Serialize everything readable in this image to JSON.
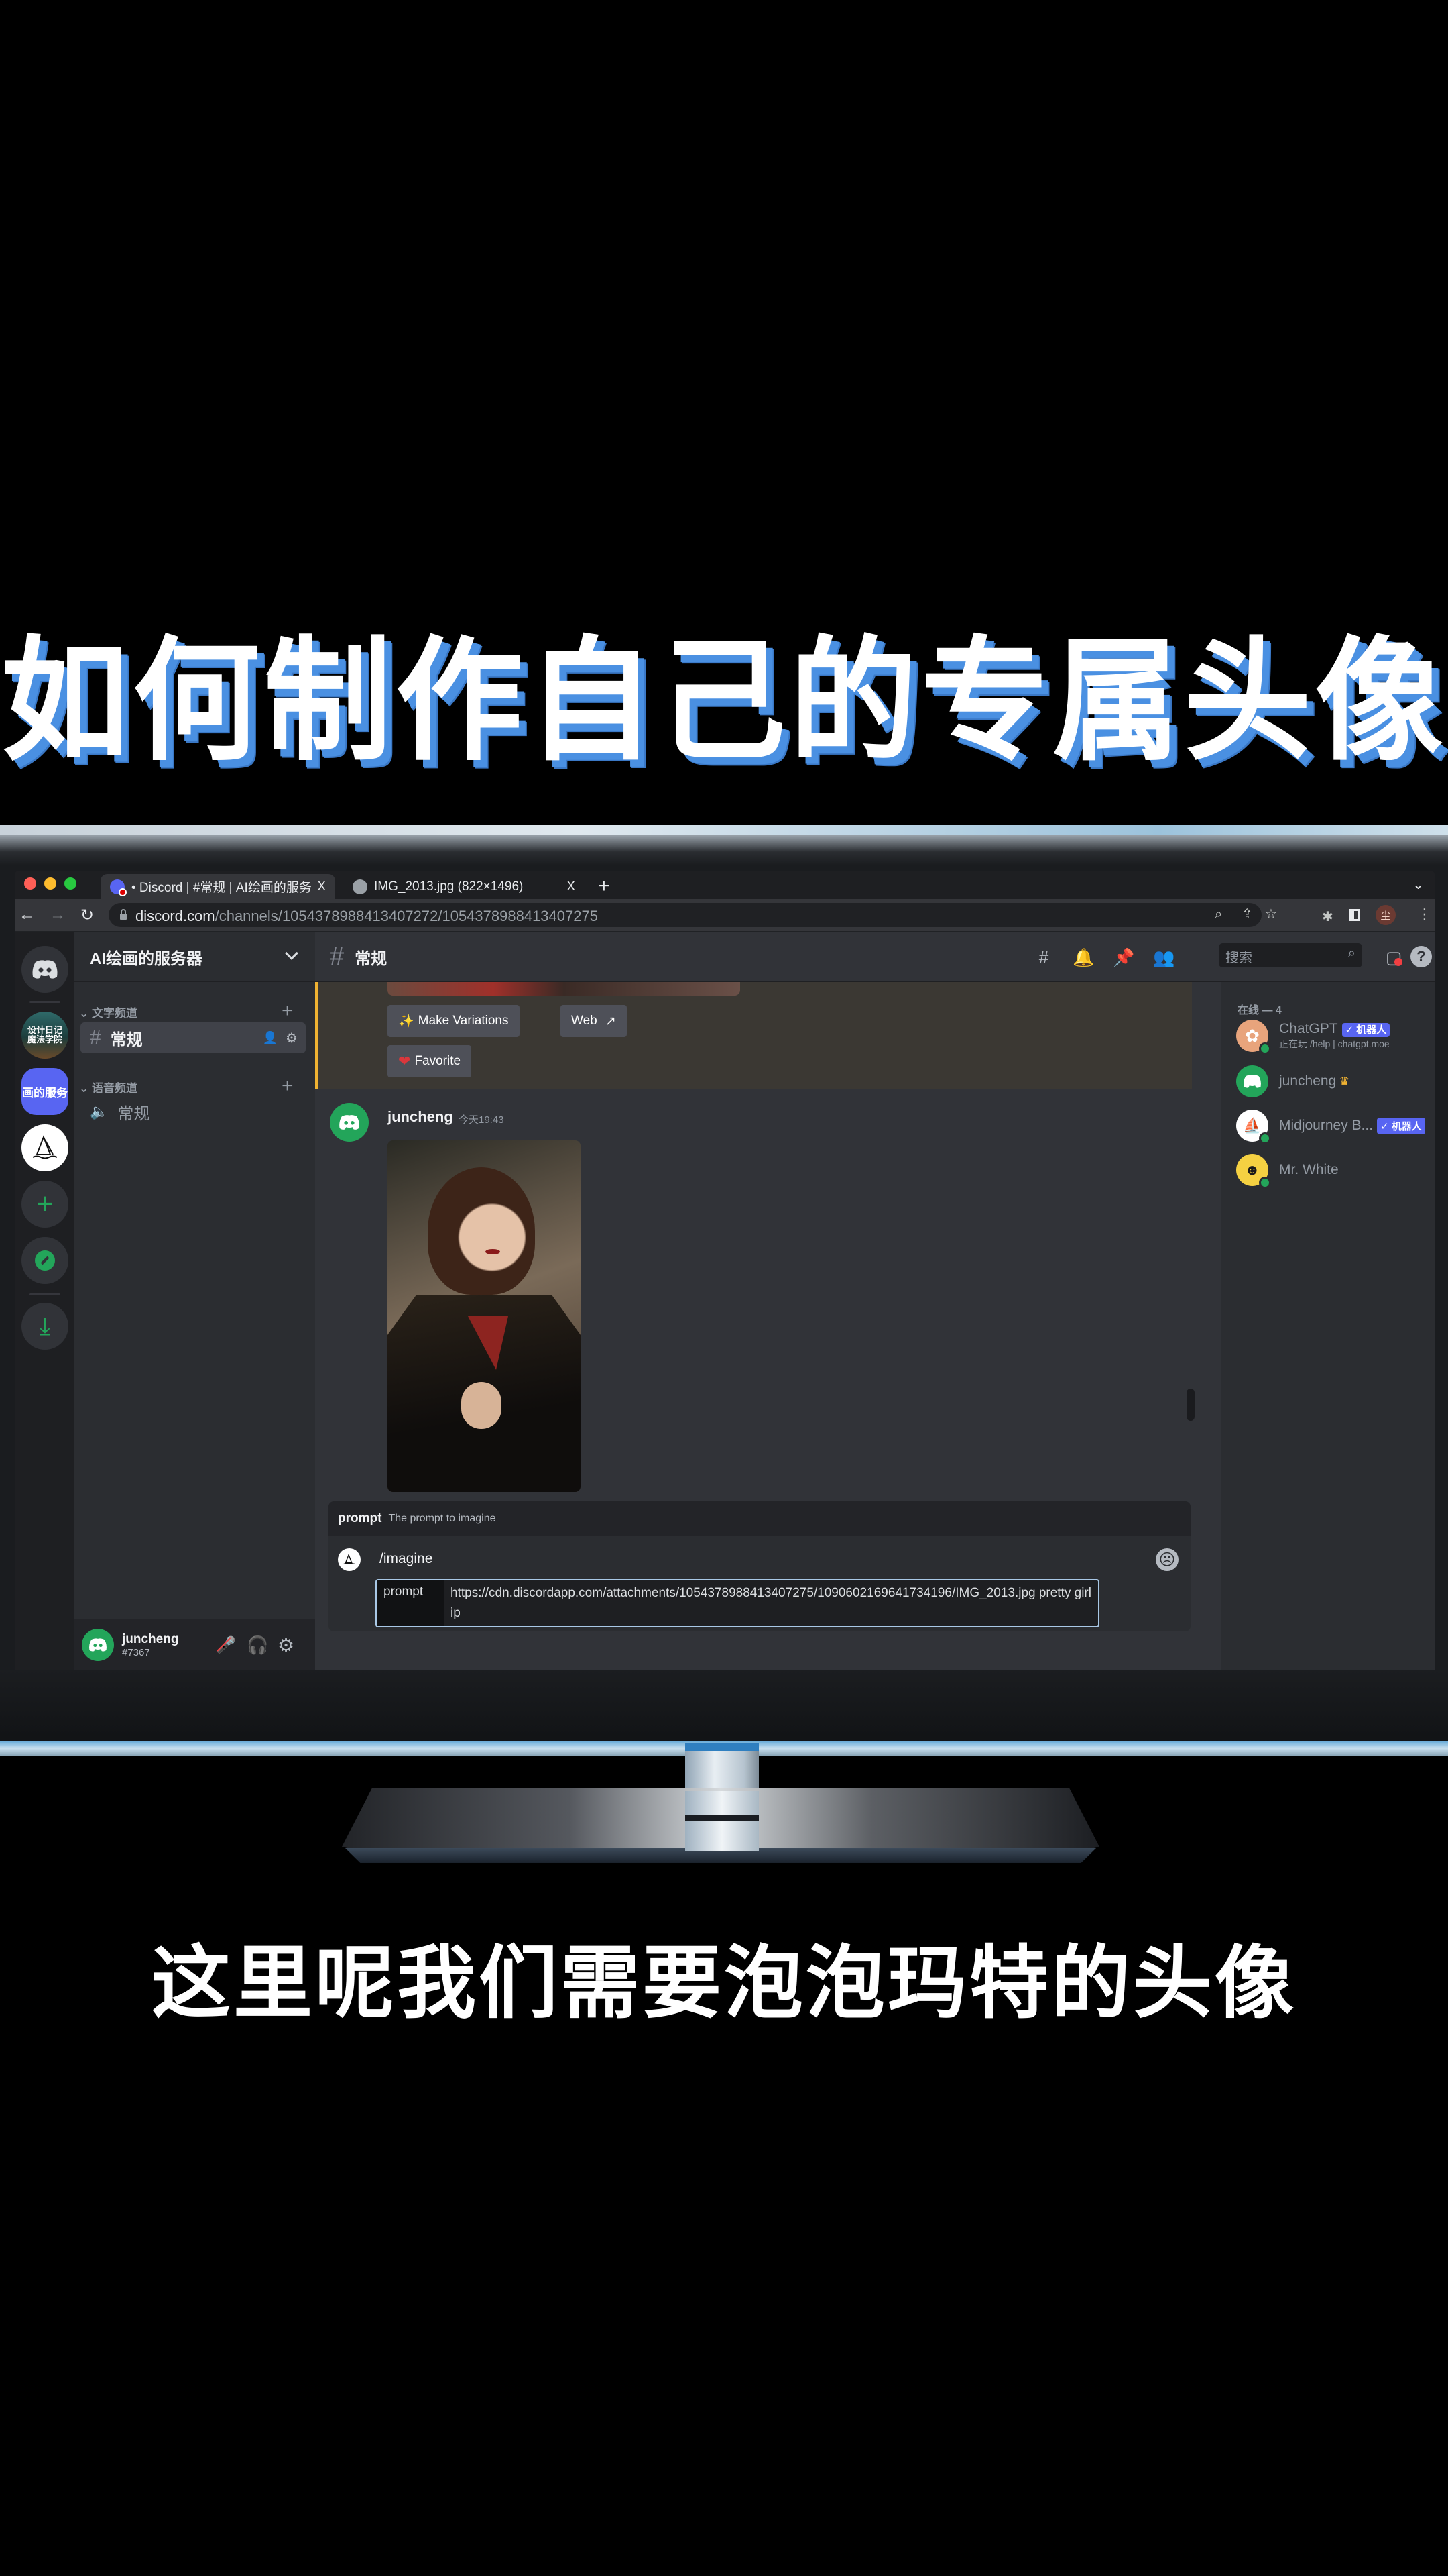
{
  "headline": "如何制作自己的专属头像",
  "subtitle": "这里呢我们需要泡泡玛特的头像",
  "browser": {
    "tabs": [
      {
        "label": "• Discord | #常规 | AI绘画的服务",
        "active": true,
        "icon": "discord-favicon"
      },
      {
        "label": "IMG_2013.jpg (822×1496)",
        "active": false,
        "icon": "globe-icon"
      }
    ],
    "new_tab": "+",
    "close": "X",
    "url_host": "discord.com",
    "url_path": "/channels/1054378988413407272/1054378988413407275",
    "profile_initial": "尘"
  },
  "discord": {
    "server_name": "AI绘画的服务器",
    "guild_labels": {
      "design": "设计日记\n魔法学院",
      "active": "画的服务"
    },
    "categories": [
      {
        "label": "文字频道",
        "channels": [
          {
            "name": "常规",
            "type": "text",
            "selected": true
          }
        ]
      },
      {
        "label": "语音频道",
        "channels": [
          {
            "name": "常规",
            "type": "voice",
            "selected": false
          }
        ]
      }
    ],
    "user": {
      "name": "juncheng",
      "tag": "#7367"
    },
    "channel_title": "常规",
    "search_placeholder": "搜索",
    "buttons": {
      "make_variations": "Make Variations",
      "web": "Web",
      "favorite": "Favorite"
    },
    "message": {
      "author": "juncheng",
      "time": "今天19:43"
    },
    "command": {
      "hint_name": "prompt",
      "hint_desc": "The prompt to imagine",
      "name": "/imagine",
      "option_label": "prompt",
      "option_value": "https://cdn.discordapp.com/attachments/1054378988413407275/1090602169641734196/IMG_2013.jpg pretty girl ip"
    },
    "members_header": "在线 — 4",
    "members": [
      {
        "name": "ChatGPT",
        "bot": true,
        "bot_label": "✓ 机器人",
        "activity": "正在玩 /help | chatgpt.moe",
        "avatar_color": "#e8a47c"
      },
      {
        "name": "juncheng",
        "bot": false,
        "crown": "♛",
        "avatar_color": "#23a55a"
      },
      {
        "name": "Midjourney B...",
        "bot": true,
        "bot_label": "✓ 机器人",
        "avatar_color": "#ffffff"
      },
      {
        "name": "Mr. White",
        "bot": false,
        "avatar_color": "#f5d142"
      }
    ]
  }
}
